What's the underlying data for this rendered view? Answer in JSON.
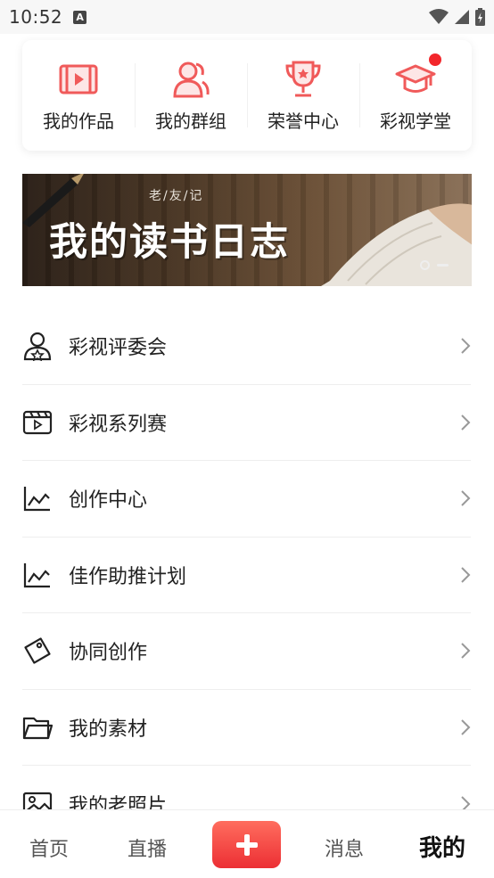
{
  "status_bar": {
    "time": "10:52",
    "notification_icon": "A"
  },
  "top_tiles": [
    {
      "label": "我的作品",
      "icon": "video-icon"
    },
    {
      "label": "我的群组",
      "icon": "group-icon"
    },
    {
      "label": "荣誉中心",
      "icon": "trophy-icon"
    },
    {
      "label": "彩视学堂",
      "icon": "graduation-cap-icon",
      "badge": true
    }
  ],
  "banner": {
    "subtitle": "老/友/记",
    "title": "我的读书日志"
  },
  "menu": [
    {
      "label": "彩视评委会",
      "icon": "judge-user-icon"
    },
    {
      "label": "彩视系列赛",
      "icon": "clapperboard-icon"
    },
    {
      "label": "创作中心",
      "icon": "line-chart-icon"
    },
    {
      "label": "佳作助推计划",
      "icon": "line-chart-icon"
    },
    {
      "label": "协同创作",
      "icon": "tag-icon"
    },
    {
      "label": "我的素材",
      "icon": "folder-icon"
    },
    {
      "label": "我的老照片",
      "icon": "photo-icon"
    }
  ],
  "bottom_nav": {
    "home": "首页",
    "live": "直播",
    "messages": "消息",
    "mine": "我的"
  },
  "colors": {
    "accent": "#ec2f34",
    "icon_red": "#f05a5a",
    "text": "#222222"
  }
}
